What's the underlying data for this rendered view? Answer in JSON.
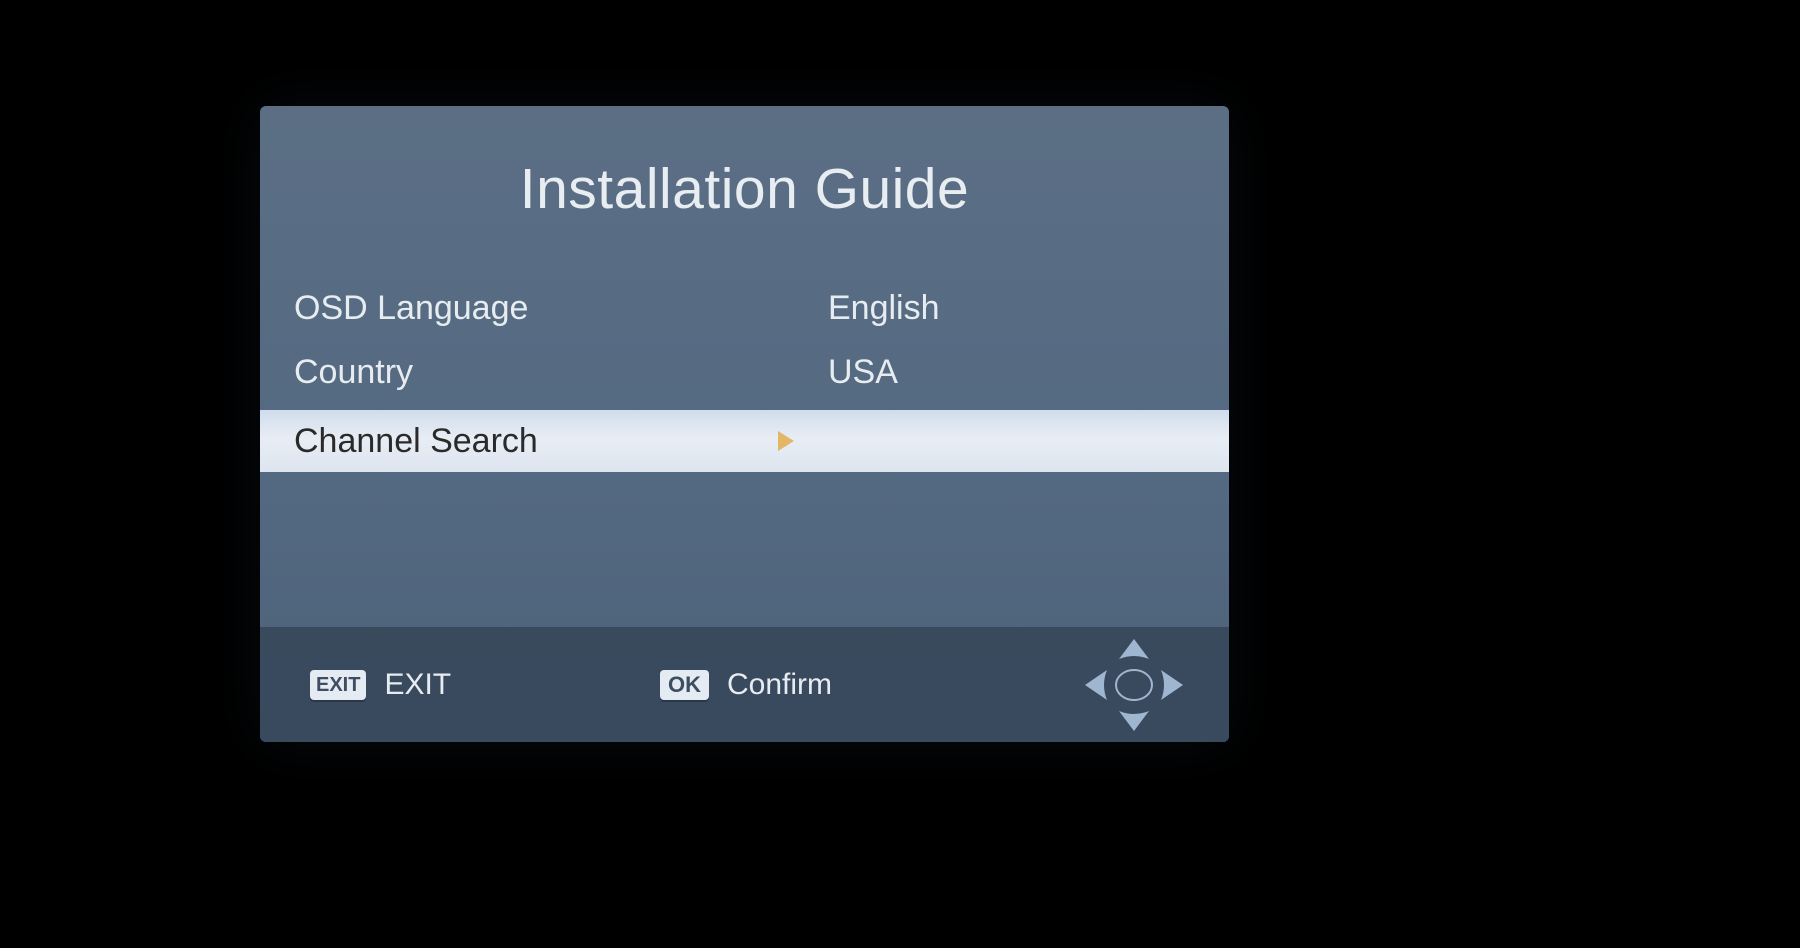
{
  "title": "Installation Guide",
  "menu": {
    "items": [
      {
        "label": "OSD Language",
        "value": "English",
        "selected": false
      },
      {
        "label": "Country",
        "value": "USA",
        "selected": false
      },
      {
        "label": "Channel Search",
        "value": "",
        "selected": true
      }
    ]
  },
  "footer": {
    "exit_badge": "EXIT",
    "exit_label": "EXIT",
    "ok_badge": "OK",
    "ok_label": "Confirm"
  }
}
